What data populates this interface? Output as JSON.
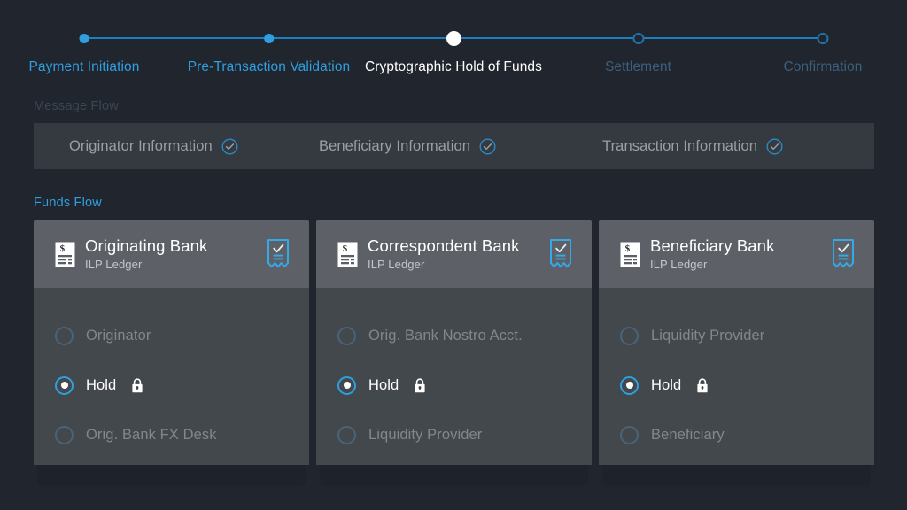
{
  "stepper": {
    "steps": [
      {
        "label": "Payment Initiation",
        "state": "done"
      },
      {
        "label": "Pre-Transaction Validation",
        "state": "done"
      },
      {
        "label": "Cryptographic Hold of Funds",
        "state": "current"
      },
      {
        "label": "Settlement",
        "state": "future"
      },
      {
        "label": "Confirmation",
        "state": "future"
      }
    ],
    "colors": {
      "done": "#2f9fe0",
      "current": "#ffffff",
      "future": "#3c5f7d",
      "track": "#1c7fc4"
    }
  },
  "message_flow": {
    "label": "Message Flow",
    "items": [
      {
        "label": "Originator Information",
        "status_icon": "check-circle-icon",
        "checked": true
      },
      {
        "label": "Beneficiary Information",
        "status_icon": "check-circle-icon",
        "checked": true
      },
      {
        "label": "Transaction Information",
        "status_icon": "check-circle-icon",
        "checked": true
      }
    ]
  },
  "funds_flow": {
    "label": "Funds Flow",
    "cards": [
      {
        "title": "Originating Bank",
        "subtitle": "ILP Ledger",
        "left_icon": "invoice-document-icon",
        "right_icon": "receipt-check-ribbon-icon",
        "options": [
          {
            "label": "Originator",
            "selected": false,
            "locked": false
          },
          {
            "label": "Hold",
            "selected": true,
            "locked": true,
            "lock_icon": "lock-icon"
          },
          {
            "label": "Orig. Bank FX Desk",
            "selected": false,
            "locked": false
          }
        ]
      },
      {
        "title": "Correspondent Bank",
        "subtitle": "ILP Ledger",
        "left_icon": "invoice-document-icon",
        "right_icon": "receipt-check-ribbon-icon",
        "options": [
          {
            "label": "Orig. Bank Nostro Acct.",
            "selected": false,
            "locked": false
          },
          {
            "label": "Hold",
            "selected": true,
            "locked": true,
            "lock_icon": "lock-icon"
          },
          {
            "label": "Liquidity Provider",
            "selected": false,
            "locked": false
          }
        ]
      },
      {
        "title": "Beneficiary Bank",
        "subtitle": "ILP Ledger",
        "left_icon": "invoice-document-icon",
        "right_icon": "receipt-check-ribbon-icon",
        "options": [
          {
            "label": "Liquidity Provider",
            "selected": false,
            "locked": false
          },
          {
            "label": "Hold",
            "selected": true,
            "locked": true,
            "lock_icon": "lock-icon"
          },
          {
            "label": "Beneficiary",
            "selected": false,
            "locked": false
          }
        ]
      }
    ]
  },
  "theme": {
    "background": "#21262e",
    "bar_background": "#343a40",
    "card_header": "#5d6167",
    "card_body": "#43484d",
    "accent": "#2f9fe0"
  }
}
